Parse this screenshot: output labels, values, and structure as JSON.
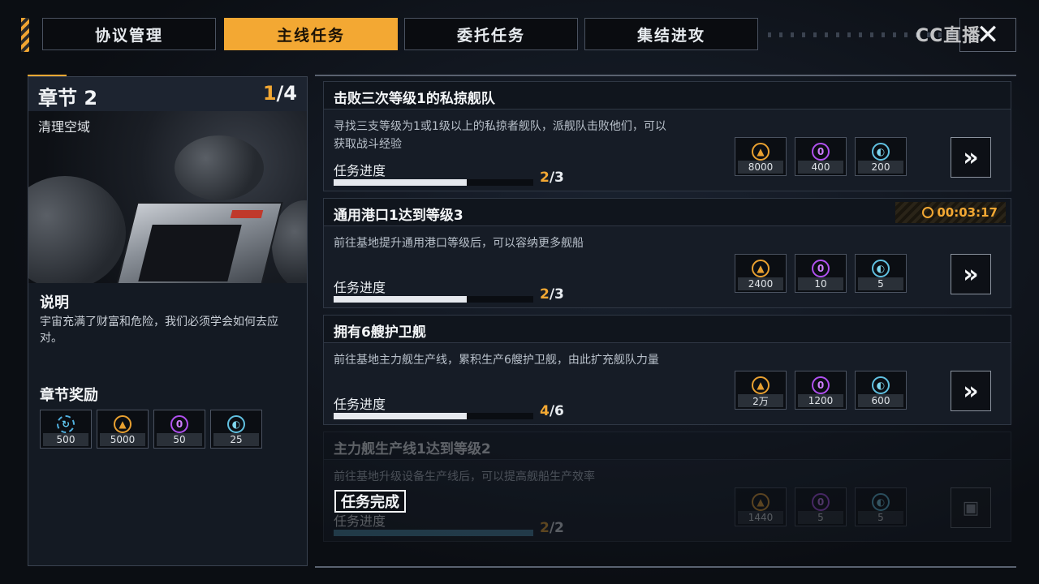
{
  "tabs": [
    "协议管理",
    "主线任务",
    "委托任务",
    "集结进攻"
  ],
  "active_tab": 1,
  "watermark": "CC直播",
  "close_label": "✕",
  "chapter": {
    "title": "章节 2",
    "progress_current": "1",
    "progress_total": "/4",
    "subtitle": "清理空域",
    "desc_heading": "说明",
    "desc": "宇宙充满了财富和危险，我们必须学会如何去应对。",
    "rewards_heading": "章节奖励",
    "rewards": [
      {
        "icon": "cycle-icon",
        "value": "500"
      },
      {
        "icon": "ore-icon",
        "value": "5000"
      },
      {
        "icon": "gem-icon",
        "value": "50"
      },
      {
        "icon": "crystal-icon",
        "value": "25"
      }
    ]
  },
  "tasks": [
    {
      "title": "击败三次等级1的私掠舰队",
      "desc": "寻找三支等级为1或1级以上的私掠者舰队，派舰队击败他们，可以获取战斗经验",
      "progress_label": "任务进度",
      "progress_current": "2",
      "progress_total": "/3",
      "progress_fraction": 0.667,
      "rewards": [
        "8000",
        "400",
        "200"
      ],
      "timer": ""
    },
    {
      "title": "通用港口1达到等级3",
      "desc": "前往基地提升通用港口等级后，可以容纳更多舰船",
      "progress_label": "任务进度",
      "progress_current": "2",
      "progress_total": "/3",
      "progress_fraction": 0.667,
      "rewards": [
        "2400",
        "10",
        "5"
      ],
      "timer": "00:03:17"
    },
    {
      "title": "拥有6艘护卫舰",
      "desc": "前往基地主力舰生产线，累积生产6艘护卫舰，由此扩充舰队力量",
      "progress_label": "任务进度",
      "progress_current": "4",
      "progress_total": "/6",
      "progress_fraction": 0.667,
      "rewards": [
        "2万",
        "1200",
        "600"
      ],
      "timer": ""
    },
    {
      "title": "主力舰生产线1达到等级2",
      "desc": "前往基地升级设备生产线后，可以提高舰船生产效率",
      "progress_label": "任务进度",
      "progress_current": "2",
      "progress_total": "/2",
      "progress_fraction": 1.0,
      "rewards": [
        "1440",
        "5",
        "5"
      ],
      "timer": "",
      "completed_label": "任务完成"
    }
  ],
  "colors": {
    "accent": "#f3a833",
    "panel": "#161c26",
    "ore": "#e8a030",
    "gem": "#b050f0",
    "crystal": "#60c0e0"
  }
}
